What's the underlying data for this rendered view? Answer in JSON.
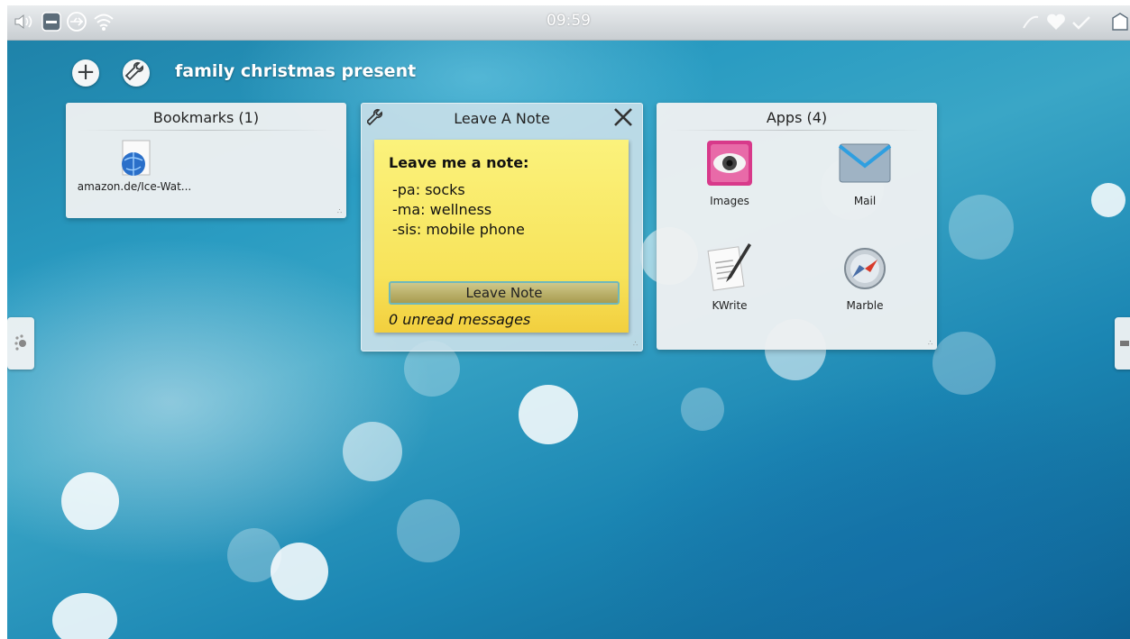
{
  "panel": {
    "clock": "09:59",
    "left_icons": [
      "volume-icon",
      "network-disconnect-icon",
      "usb-icon",
      "wifi-icon"
    ],
    "right_icons": [
      "battery-icon",
      "favorite-heart-icon",
      "updates-icon",
      "device-icon"
    ]
  },
  "activity": {
    "title": "family christmas present",
    "add_icon": "plus-icon",
    "config_icon": "wrench-icon"
  },
  "bookmarks_widget": {
    "title": "Bookmarks (1)",
    "items": [
      {
        "label": "amazon.de/Ice-Wat...",
        "icon": "web-page-icon"
      }
    ]
  },
  "note_widget": {
    "title": "Leave A Note",
    "heading": "Leave me a note:",
    "lines": [
      "-pa: socks",
      "-ma: wellness",
      "-sis: mobile phone"
    ],
    "button_label": "Leave Note",
    "status": "0 unread messages"
  },
  "apps_widget": {
    "title": "Apps (4)",
    "items": [
      {
        "label": "Images",
        "icon": "image-viewer-icon"
      },
      {
        "label": "Mail",
        "icon": "mail-envelope-icon"
      },
      {
        "label": "KWrite",
        "icon": "text-editor-pen-icon"
      },
      {
        "label": "Marble",
        "icon": "compass-icon"
      }
    ]
  },
  "colors": {
    "sticky_note": "#f7e35a",
    "wallpaper": "#2a9cc2",
    "button_border": "#6fb8bc"
  }
}
